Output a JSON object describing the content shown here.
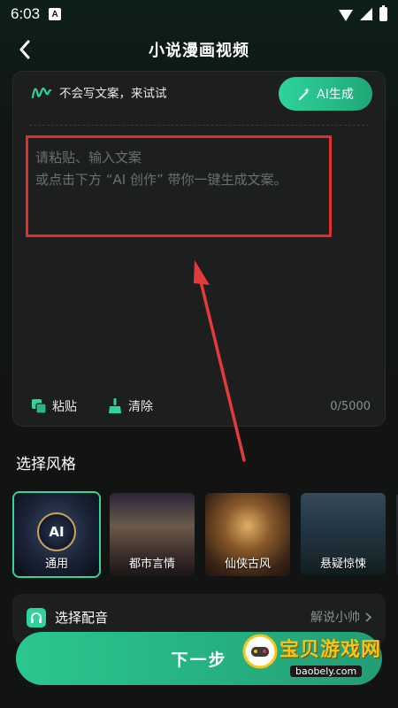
{
  "status_bar": {
    "time": "6:03",
    "notification": "A"
  },
  "header": {
    "title": "小说漫画视频"
  },
  "editor": {
    "prompt": "不会写文案，来试试",
    "ai_button": "AI生成",
    "placeholder_line1": "请粘贴、输入文案",
    "placeholder_line2": "或点击下方 “AI 创作” 带你一键生成文案。",
    "paste_label": "粘贴",
    "clear_label": "清除",
    "char_count": "0/5000"
  },
  "styles": {
    "title": "选择风格",
    "items": [
      {
        "label": "通用",
        "badge": "AI",
        "selected": true
      },
      {
        "label": "都市言情",
        "selected": false
      },
      {
        "label": "仙侠古风",
        "selected": false
      },
      {
        "label": "悬疑惊悚",
        "selected": false
      }
    ]
  },
  "voice": {
    "label": "选择配音",
    "value": "解说小帅"
  },
  "next_button": {
    "label": "下一步"
  },
  "watermark": {
    "text": "宝贝游戏网",
    "url": "baobely.com"
  },
  "colors": {
    "accent": "#2fd39b",
    "highlight_box": "#e02e2e",
    "background": "#111413"
  },
  "icons": [
    "back-arrow-icon",
    "wave-icon",
    "magic-wand-icon",
    "paste-icon",
    "broom-icon",
    "headphone-icon",
    "chevron-right-icon"
  ]
}
